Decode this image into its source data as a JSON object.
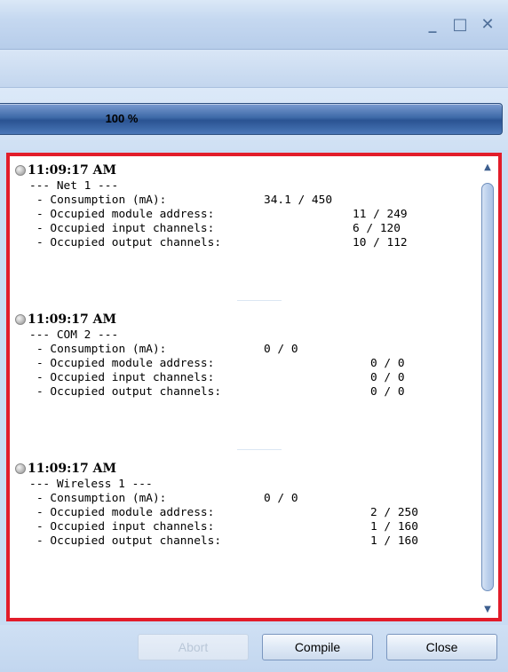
{
  "window": {
    "minimize_glyph": "_",
    "maximize_glyph": "□",
    "close_glyph": "✕"
  },
  "progress": {
    "label": "100 %",
    "value": 1.0
  },
  "log": {
    "entries": [
      {
        "time": "11:09:17 AM",
        "header": "--- Net 1 ---",
        "rows": [
          {
            "label": "- Consumption (mA):",
            "value": "34.1 / 450"
          },
          {
            "label": "- Occupied module address:",
            "value": "11 / 249"
          },
          {
            "label": "- Occupied input channels:",
            "value": "6 / 120"
          },
          {
            "label": "- Occupied output channels:",
            "value": "10 / 112"
          }
        ]
      },
      {
        "time": "11:09:17 AM",
        "header": "--- COM 2 ---",
        "rows": [
          {
            "label": "- Consumption (mA):",
            "value": "0 / 0"
          },
          {
            "label": "- Occupied module address:",
            "value": "0 / 0"
          },
          {
            "label": "- Occupied input channels:",
            "value": "0 / 0"
          },
          {
            "label": "- Occupied output channels:",
            "value": "0 / 0"
          }
        ]
      },
      {
        "time": "11:09:17 AM",
        "header": "--- Wireless 1 ---",
        "rows": [
          {
            "label": "- Consumption (mA):",
            "value": "0 / 0"
          },
          {
            "label": "- Occupied module address:",
            "value": "2 / 250"
          },
          {
            "label": "- Occupied input channels:",
            "value": "1 / 160"
          },
          {
            "label": "- Occupied output channels:",
            "value": "1 / 160"
          }
        ]
      }
    ]
  },
  "buttons": {
    "abort": "Abort",
    "compile": "Compile",
    "close": "Close"
  },
  "scroll": {
    "up_glyph": "▲",
    "down_glyph": "▼"
  },
  "colors": {
    "highlight_border": "#e21c2a",
    "progress_fill": "#2a5392"
  }
}
